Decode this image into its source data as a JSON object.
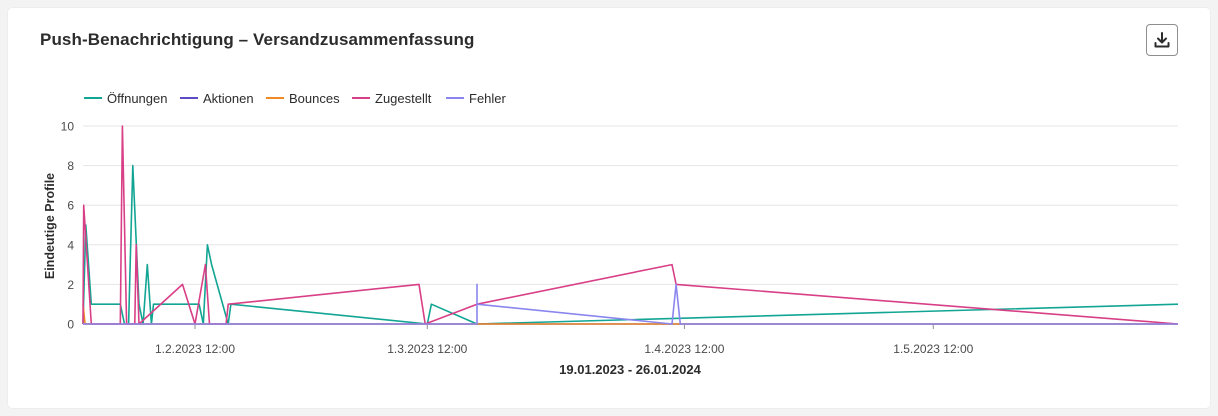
{
  "card": {
    "title": "Push-Benachrichtigung – Versandzusammenfassung",
    "download_icon": "download-icon"
  },
  "colors": {
    "grid": "#e6e6e6",
    "axis_text": "#4b4b4b",
    "title_text": "#2c2c2c"
  },
  "chart_data": {
    "type": "line",
    "ylabel": "Eindeutige Profile",
    "xlabel": "19.01.2023 - 26.01.2024",
    "ylim": [
      0,
      10
    ],
    "yticks": [
      0,
      2,
      4,
      6,
      8,
      10
    ],
    "xrange": [
      "2023-01-19 00:00",
      "2023-05-31 00:00"
    ],
    "xticks": [
      {
        "date": "2023-02-01 12:00",
        "label": "1.2.2023 12:00"
      },
      {
        "date": "2023-03-01 12:00",
        "label": "1.3.2023 12:00"
      },
      {
        "date": "2023-04-01 12:00",
        "label": "1.4.2023 12:00"
      },
      {
        "date": "2023-05-01 12:00",
        "label": "1.5.2023 12:00"
      }
    ],
    "grid": true,
    "legend_position": "top-left",
    "series": [
      {
        "name": "Öffnungen",
        "color": "#12a594",
        "points": [
          [
            "2023-01-19 00:00",
            0
          ],
          [
            "2023-01-19 08:00",
            5
          ],
          [
            "2023-01-20 00:00",
            1
          ],
          [
            "2023-01-23 12:00",
            1
          ],
          [
            "2023-01-24 00:00",
            0
          ],
          [
            "2023-01-24 12:00",
            0
          ],
          [
            "2023-01-25 00:00",
            8
          ],
          [
            "2023-01-25 18:00",
            1
          ],
          [
            "2023-01-26 06:00",
            0
          ],
          [
            "2023-01-26 18:00",
            3
          ],
          [
            "2023-01-27 06:00",
            0
          ],
          [
            "2023-01-27 12:00",
            1
          ],
          [
            "2023-02-02 00:00",
            1
          ],
          [
            "2023-02-02 12:00",
            0
          ],
          [
            "2023-02-03 00:00",
            4
          ],
          [
            "2023-02-03 12:00",
            3
          ],
          [
            "2023-02-05 12:00",
            0
          ],
          [
            "2023-02-05 20:00",
            1
          ],
          [
            "2023-03-01 12:00",
            0
          ],
          [
            "2023-03-02 00:00",
            1
          ],
          [
            "2023-03-07 12:00",
            0
          ],
          [
            "2023-05-31 00:00",
            1
          ]
        ]
      },
      {
        "name": "Aktionen",
        "color": "#5b4bc4",
        "points": [
          [
            "2023-01-19 00:00",
            0
          ],
          [
            "2023-05-31 00:00",
            0
          ]
        ]
      },
      {
        "name": "Bounces",
        "color": "#f08a24",
        "points": [
          [
            "2023-01-19 00:00",
            1
          ],
          [
            "2023-01-19 06:00",
            0
          ],
          [
            "2023-05-31 00:00",
            0
          ]
        ]
      },
      {
        "name": "Zugestellt",
        "color": "#d83f87",
        "points": [
          [
            "2023-01-19 00:00",
            0
          ],
          [
            "2023-01-19 02:00",
            6
          ],
          [
            "2023-01-20 00:00",
            0
          ],
          [
            "2023-01-23 12:00",
            0
          ],
          [
            "2023-01-23 18:00",
            10
          ],
          [
            "2023-01-24 06:00",
            0
          ],
          [
            "2023-01-25 06:00",
            0
          ],
          [
            "2023-01-25 10:00",
            4
          ],
          [
            "2023-01-25 18:00",
            0
          ],
          [
            "2023-01-31 00:00",
            2
          ],
          [
            "2023-02-01 12:00",
            0
          ],
          [
            "2023-02-02 18:00",
            3
          ],
          [
            "2023-02-03 06:00",
            0
          ],
          [
            "2023-02-05 06:00",
            0
          ],
          [
            "2023-02-05 12:00",
            1
          ],
          [
            "2023-02-28 12:00",
            2
          ],
          [
            "2023-03-01 06:00",
            0
          ],
          [
            "2023-03-07 12:00",
            1
          ],
          [
            "2023-03-31 00:00",
            3
          ],
          [
            "2023-03-31 12:00",
            2
          ],
          [
            "2023-05-31 00:00",
            0
          ]
        ]
      },
      {
        "name": "Fehler",
        "color": "#8a86ee",
        "points": [
          [
            "2023-01-19 00:00",
            0
          ],
          [
            "2023-03-07 12:00",
            0
          ],
          [
            "2023-03-07 12:00",
            2
          ],
          [
            "2023-03-07 12:00",
            1
          ],
          [
            "2023-03-31 00:00",
            0
          ],
          [
            "2023-03-31 12:00",
            2
          ],
          [
            "2023-04-01 00:00",
            0
          ],
          [
            "2023-05-31 00:00",
            0
          ]
        ]
      }
    ]
  }
}
